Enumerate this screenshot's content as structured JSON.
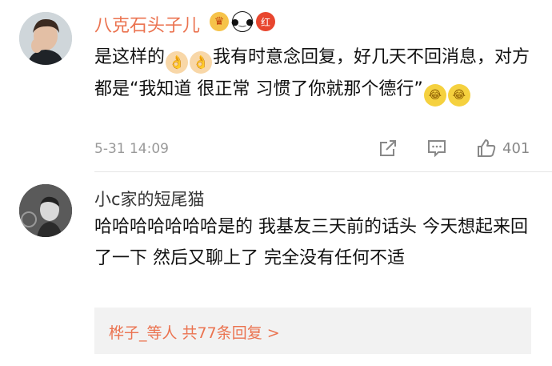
{
  "comments": [
    {
      "username": "八克石头子儿",
      "text_part1": "是这样的",
      "text_part2": "我有时意念回复，好几天不回消息，对方都是“我知道 很正常 习惯了你就那个德行”",
      "badges": [
        "crown-badge-icon",
        "panda-badge-icon",
        "red-badge-icon"
      ],
      "red_badge_label": "红",
      "time": "5-31 14:09",
      "like_count": "401"
    },
    {
      "username": "小c家的短尾猫",
      "text": "哈哈哈哈哈哈哈是的 我基友三天前的话头 今天想起来回了一下 然后又聊上了 完全没有任何不适"
    }
  ],
  "replies_summary": "桦子_等人 共77条回复 >",
  "colors": {
    "accent": "#eb7350",
    "muted": "#999999"
  }
}
